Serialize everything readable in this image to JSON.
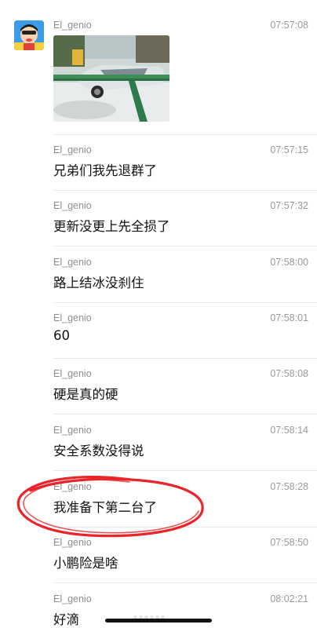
{
  "messages": [
    {
      "sender": "El_genio",
      "time": "07:57:08",
      "type": "image"
    },
    {
      "sender": "El_genio",
      "time": "07:57:15",
      "text": "兄弟们我先退群了"
    },
    {
      "sender": "El_genio",
      "time": "07:57:32",
      "text": "更新没更上先全损了"
    },
    {
      "sender": "El_genio",
      "time": "07:58:00",
      "text": "路上结冰没刹住"
    },
    {
      "sender": "El_genio",
      "time": "07:58:01",
      "text": "60"
    },
    {
      "sender": "El_genio",
      "time": "07:58:08",
      "text": "硬是真的硬"
    },
    {
      "sender": "El_genio",
      "time": "07:58:14",
      "text": "安全系数没得说"
    },
    {
      "sender": "El_genio",
      "time": "07:58:28",
      "text": "我准备下第二台了"
    },
    {
      "sender": "El_genio",
      "time": "07:58:50",
      "text": "小鹏险是啥"
    },
    {
      "sender": "El_genio",
      "time": "08:02:21",
      "text": "好滴"
    }
  ],
  "colors": {
    "highlight_circle": "#e8252b",
    "separator": "#e8e8e8"
  },
  "icons": {
    "avatar": "cartoon-avatar",
    "highlight": "red-circle-annotation"
  }
}
